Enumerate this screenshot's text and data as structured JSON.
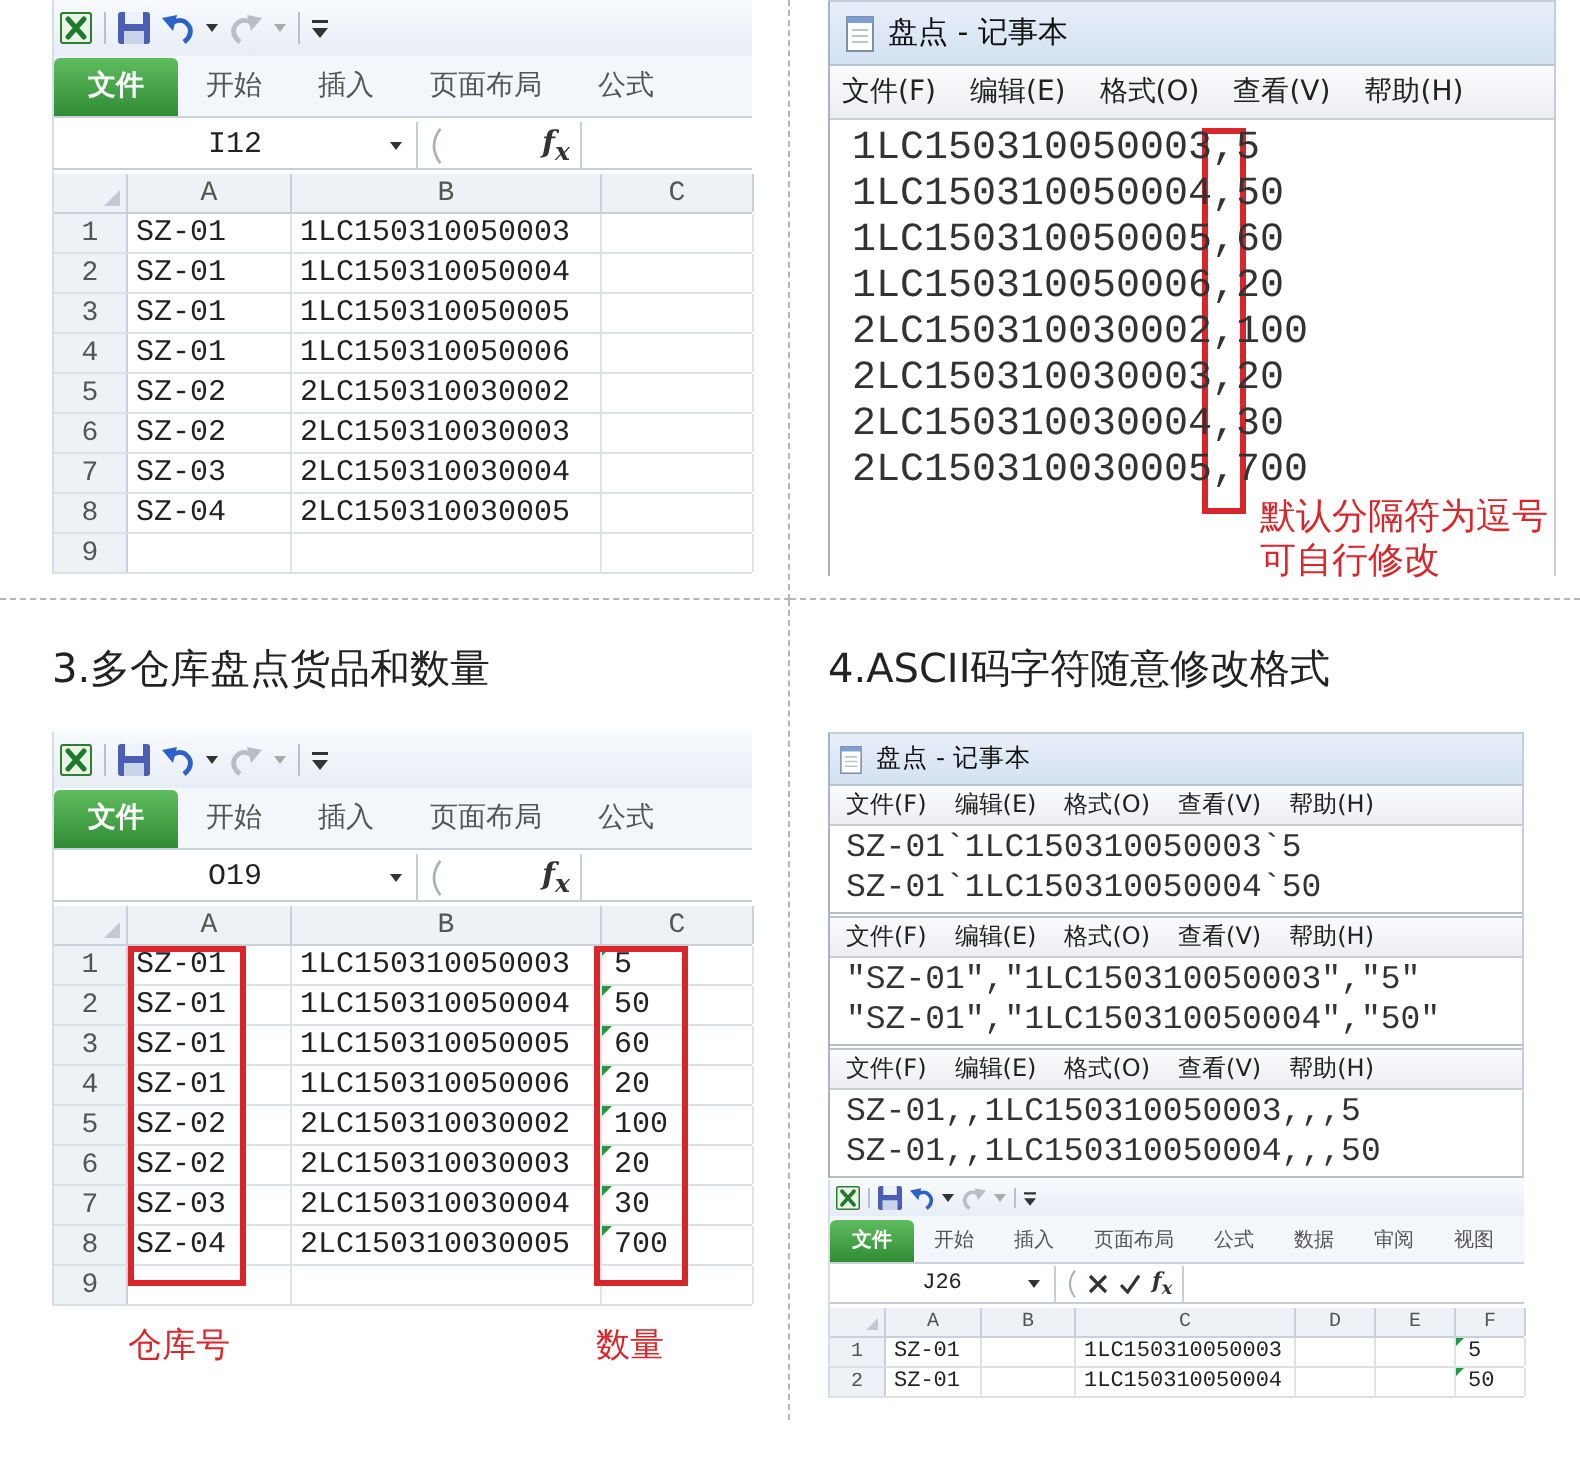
{
  "quadrants": [
    {
      "blocks": [
        {
          "kind": "spreadsheet",
          "tabs": [
            {
              "label": "文件",
              "kind": "file"
            },
            {
              "label": "开始",
              "kind": "tab"
            },
            {
              "label": "插入",
              "kind": "tab"
            },
            {
              "label": "页面布局",
              "kind": "tab"
            },
            {
              "label": "公式",
              "kind": "tab"
            }
          ],
          "name_box": "I12",
          "formula_editing": false,
          "function_button": "f$_{x}$",
          "columns": [
            {
              "label": "A",
              "highlighted": false
            },
            {
              "label": "B",
              "highlighted": false
            },
            {
              "label": "C",
              "highlighted": false
            }
          ],
          "rows": [
            {
              "number": "1",
              "cells": [
                {
                  "text": "SZ-01",
                  "error_indicator": false
                },
                {
                  "text": "1LC150310050003",
                  "error_indicator": false
                }
              ]
            },
            {
              "number": "2",
              "cells": [
                {
                  "text": "SZ-01",
                  "error_indicator": false
                },
                {
                  "text": "1LC150310050004",
                  "error_indicator": false
                }
              ]
            },
            {
              "number": "3",
              "cells": [
                {
                  "text": "SZ-01",
                  "error_indicator": false
                },
                {
                  "text": "1LC150310050005",
                  "error_indicator": false
                }
              ]
            },
            {
              "number": "4",
              "cells": [
                {
                  "text": "SZ-01",
                  "error_indicator": false
                },
                {
                  "text": "1LC150310050006",
                  "error_indicator": false
                }
              ]
            },
            {
              "number": "5",
              "cells": [
                {
                  "text": "SZ-02",
                  "error_indicator": false
                },
                {
                  "text": "2LC150310030002",
                  "error_indicator": false
                }
              ]
            },
            {
              "number": "6",
              "cells": [
                {
                  "text": "SZ-02",
                  "error_indicator": false
                },
                {
                  "text": "2LC150310030003",
                  "error_indicator": false
                }
              ]
            },
            {
              "number": "7",
              "cells": [
                {
                  "text": "SZ-03",
                  "error_indicator": false
                },
                {
                  "text": "2LC150310030004",
                  "error_indicator": false
                }
              ]
            },
            {
              "number": "8",
              "cells": [
                {
                  "text": "SZ-04",
                  "error_indicator": false
                },
                {
                  "text": "2LC150310030005",
                  "error_indicator": false
                }
              ]
            },
            {
              "number": "9"
            }
          ]
        }
      ]
    },
    {
      "blocks": [
        {
          "kind": "notepad",
          "title": "盘点 - 记事本",
          "panes": [
            {
              "menu": [
                "文件(F)",
                "编辑(E)",
                "格式(O)",
                "查看(V)",
                "帮助(H)"
              ],
              "lines": [
                "1LC150310050003,5",
                "1LC150310050004,50",
                "1LC150310050005,60",
                "1LC150310050006,20",
                "2LC150310030002,100",
                "2LC150310030003,20",
                "2LC150310030004,30",
                "2LC150310030005,700"
              ],
              "separator_highlighted": true,
              "annotation": "默认分隔符为逗号可自行修改"
            }
          ]
        }
      ]
    },
    {
      "blocks": [
        {
          "kind": "heading",
          "text": "3.多仓库盘点货品和数量"
        },
        {
          "kind": "spreadsheet",
          "tabs": [
            {
              "label": "文件",
              "kind": "file"
            },
            {
              "label": "开始",
              "kind": "tab"
            },
            {
              "label": "插入",
              "kind": "tab"
            },
            {
              "label": "页面布局",
              "kind": "tab"
            },
            {
              "label": "公式",
              "kind": "tab"
            }
          ],
          "name_box": "O19",
          "formula_editing": false,
          "function_button": "f$_{x}$",
          "columns": [
            {
              "label": "A",
              "highlighted": true,
              "annotation": "仓库号"
            },
            {
              "label": "B",
              "highlighted": false
            },
            {
              "label": "C",
              "highlighted": true,
              "annotation": "数量"
            }
          ],
          "rows": [
            {
              "number": "1",
              "cells": [
                {
                  "text": "SZ-01",
                  "error_indicator": false
                },
                {
                  "text": "1LC150310050003",
                  "error_indicator": false
                },
                {
                  "text": "5",
                  "error_indicator": true
                }
              ]
            },
            {
              "number": "2",
              "cells": [
                {
                  "text": "SZ-01",
                  "error_indicator": false
                },
                {
                  "text": "1LC150310050004",
                  "error_indicator": false
                },
                {
                  "text": "50",
                  "error_indicator": true
                }
              ]
            },
            {
              "number": "3",
              "cells": [
                {
                  "text": "SZ-01",
                  "error_indicator": false
                },
                {
                  "text": "1LC150310050005",
                  "error_indicator": false
                },
                {
                  "text": "60",
                  "error_indicator": true
                }
              ]
            },
            {
              "number": "4",
              "cells": [
                {
                  "text": "SZ-01",
                  "error_indicator": false
                },
                {
                  "text": "1LC150310050006",
                  "error_indicator": false
                },
                {
                  "text": "20",
                  "error_indicator": true
                }
              ]
            },
            {
              "number": "5",
              "cells": [
                {
                  "text": "SZ-02",
                  "error_indicator": false
                },
                {
                  "text": "2LC150310030002",
                  "error_indicator": false
                },
                {
                  "text": "100",
                  "error_indicator": true
                }
              ]
            },
            {
              "number": "6",
              "cells": [
                {
                  "text": "SZ-02",
                  "error_indicator": false
                },
                {
                  "text": "2LC150310030003",
                  "error_indicator": false
                },
                {
                  "text": "20",
                  "error_indicator": true
                }
              ]
            },
            {
              "number": "7",
              "cells": [
                {
                  "text": "SZ-03",
                  "error_indicator": false
                },
                {
                  "text": "2LC150310030004",
                  "error_indicator": false
                },
                {
                  "text": "30",
                  "error_indicator": true
                }
              ]
            },
            {
              "number": "8",
              "cells": [
                {
                  "text": "SZ-04",
                  "error_indicator": false
                },
                {
                  "text": "2LC150310030005",
                  "error_indicator": false
                },
                {
                  "text": "700",
                  "error_indicator": true
                }
              ]
            },
            {
              "number": "9"
            }
          ]
        }
      ]
    },
    {
      "blocks": [
        {
          "kind": "heading",
          "text": "4.ASCII码字符随意修改格式"
        },
        {
          "kind": "notepad",
          "title": "盘点 - 记事本",
          "panes": [
            {
              "menu": [
                "文件(F)",
                "编辑(E)",
                "格式(O)",
                "查看(V)",
                "帮助(H)"
              ],
              "lines": [
                "SZ-01`1LC150310050003`5",
                "SZ-01`1LC150310050004`50"
              ],
              "separator_highlighted": false
            },
            {
              "menu": [
                "文件(F)",
                "编辑(E)",
                "格式(O)",
                "查看(V)",
                "帮助(H)"
              ],
              "lines": [
                "\"SZ-01\",\"1LC150310050003\",\"5\"",
                "\"SZ-01\",\"1LC150310050004\",\"50\""
              ],
              "separator_highlighted": false
            },
            {
              "menu": [
                "文件(F)",
                "编辑(E)",
                "格式(O)",
                "查看(V)",
                "帮助(H)"
              ],
              "lines": [
                "SZ-01,,1LC150310050003,,,5",
                "SZ-01,,1LC150310050004,,,50"
              ],
              "separator_highlighted": false
            }
          ]
        },
        {
          "kind": "spreadsheet",
          "tabs": [
            {
              "label": "文件",
              "kind": "file"
            },
            {
              "label": "开始",
              "kind": "tab"
            },
            {
              "label": "插入",
              "kind": "tab"
            },
            {
              "label": "页面布局",
              "kind": "tab"
            },
            {
              "label": "公式",
              "kind": "tab"
            },
            {
              "label": "数据",
              "kind": "tab"
            },
            {
              "label": "审阅",
              "kind": "tab"
            },
            {
              "label": "视图",
              "kind": "tab"
            }
          ],
          "name_box": "J26",
          "formula_editing": true,
          "function_button": "f$_{x}$",
          "columns": [
            {
              "label": "A",
              "highlighted": false
            },
            {
              "label": "B",
              "highlighted": false
            },
            {
              "label": "C",
              "highlighted": false
            },
            {
              "label": "D",
              "highlighted": false
            },
            {
              "label": "E",
              "highlighted": false
            },
            {
              "label": "F",
              "highlighted": false
            }
          ],
          "rows": [
            {
              "number": "1",
              "cells": [
                {
                  "text": "SZ-01",
                  "error_indicator": false
                },
                null,
                {
                  "text": "1LC150310050003",
                  "error_indicator": false
                },
                null,
                null,
                {
                  "text": "5",
                  "error_indicator": true
                }
              ]
            },
            {
              "number": "2",
              "cells": [
                {
                  "text": "SZ-01",
                  "error_indicator": false
                },
                null,
                {
                  "text": "1LC150310050004",
                  "error_indicator": false
                },
                null,
                null,
                {
                  "text": "50",
                  "error_indicator": true
                }
              ]
            }
          ]
        }
      ]
    }
  ]
}
